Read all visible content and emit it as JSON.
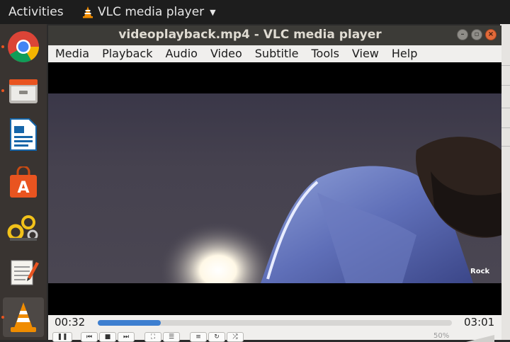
{
  "topbar": {
    "activities": "Activities",
    "app_name": "VLC media player"
  },
  "dock": {
    "items": [
      {
        "name": "chrome",
        "running": true
      },
      {
        "name": "files",
        "running": true
      },
      {
        "name": "libreoffice-writer",
        "running": false
      },
      {
        "name": "software-center",
        "running": false
      },
      {
        "name": "settings-gears",
        "running": false
      },
      {
        "name": "text-editor",
        "running": false
      },
      {
        "name": "vlc",
        "running": true,
        "active": true
      }
    ]
  },
  "window": {
    "title": "videoplayback.mp4 - VLC media player",
    "menu": [
      "Media",
      "Playback",
      "Audio",
      "Video",
      "Subtitle",
      "Tools",
      "View",
      "Help"
    ]
  },
  "video": {
    "watermark": "Rock"
  },
  "playback": {
    "elapsed": "00:32",
    "total": "03:01",
    "progress_fraction": 0.177,
    "volume": "50%"
  },
  "colors": {
    "accent": "#3e7fd0",
    "ubuntu_orange": "#e95420"
  }
}
